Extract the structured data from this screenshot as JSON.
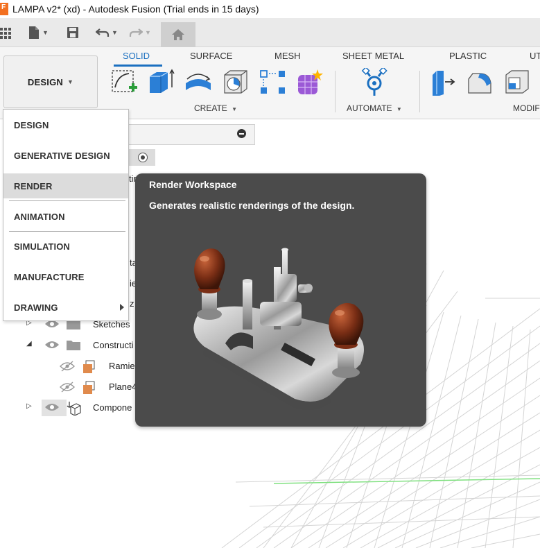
{
  "window": {
    "title": "LAMPA v2* (xd) - Autodesk Fusion (Trial ends in 15 days)"
  },
  "colors": {
    "accent": "#1a6fc0",
    "tooltip_bg": "#4b4b4b",
    "brand_orange": "#f37021"
  },
  "workspace": {
    "current": "DESIGN"
  },
  "ribbon": {
    "tabs": [
      {
        "label": "SOLID",
        "active": true
      },
      {
        "label": "SURFACE"
      },
      {
        "label": "MESH"
      },
      {
        "label": "SHEET METAL"
      },
      {
        "label": "PLASTIC"
      },
      {
        "label": "UT"
      }
    ],
    "groups": {
      "create": "CREATE",
      "automate": "AUTOMATE",
      "modify": "MODIF"
    }
  },
  "workspace_menu": {
    "items": [
      {
        "label": "DESIGN"
      },
      {
        "label": "GENERATIVE DESIGN"
      },
      {
        "label": "RENDER",
        "highlighted": true
      },
      {
        "label": "ANIMATION"
      },
      {
        "label": "SIMULATION"
      },
      {
        "label": "MANUFACTURE"
      },
      {
        "label": "DRAWING",
        "submenu": true
      }
    ]
  },
  "browser": {
    "partial_labels": [
      "tin",
      "ta",
      "ie",
      "z"
    ],
    "items": [
      {
        "label": "Sketches"
      },
      {
        "label": "Constructi"
      },
      {
        "label": "Ramie"
      },
      {
        "label": "Plane4"
      },
      {
        "label": "Compone"
      }
    ]
  },
  "tooltip": {
    "title": "Render Workspace",
    "description": "Generates realistic renderings of the design."
  }
}
